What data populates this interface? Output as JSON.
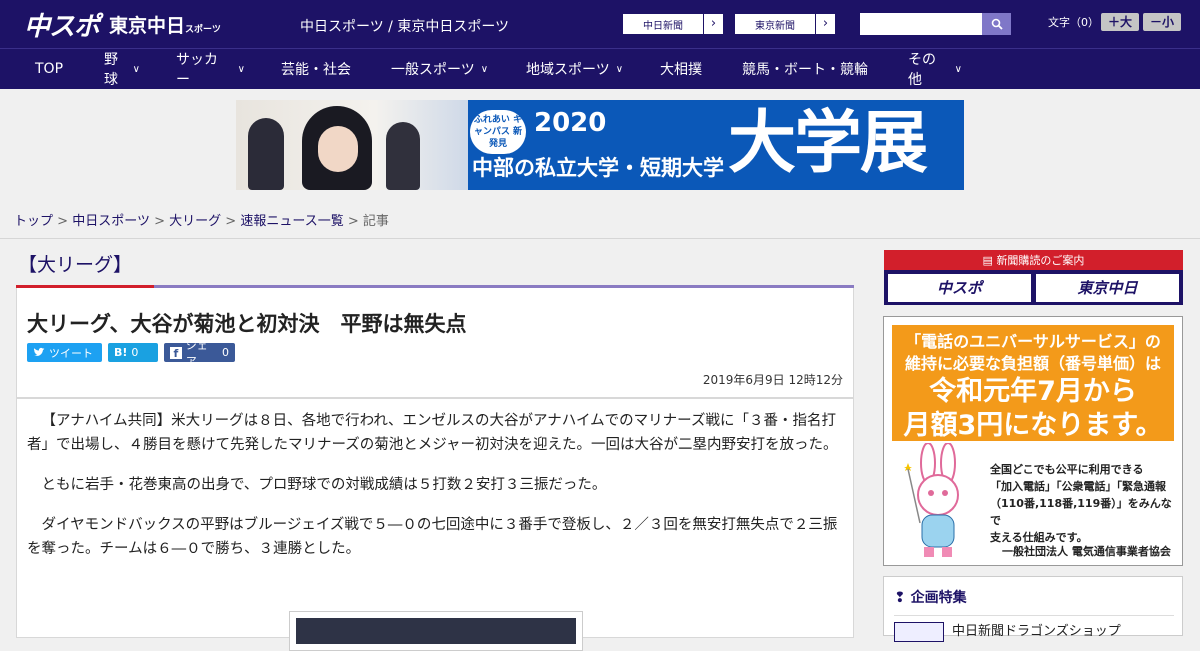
{
  "header": {
    "logo_main": "中スポ",
    "logo_sub": "東京中日",
    "logo_sub_small": "スポーツ",
    "site_title": "中日スポーツ / 東京中日スポーツ",
    "ext_links": [
      {
        "label": "中日新聞",
        "arrow": "›"
      },
      {
        "label": "東京新聞",
        "arrow": "›"
      }
    ],
    "search_placeholder": "",
    "font_size_label": "文字（0）",
    "font_up": "＋大",
    "font_down": "－小"
  },
  "nav": {
    "items": [
      {
        "label": "TOP",
        "has_menu": false
      },
      {
        "label": "野球",
        "has_menu": true
      },
      {
        "label": "サッカー",
        "has_menu": true
      },
      {
        "label": "芸能・社会",
        "has_menu": false
      },
      {
        "label": "一般スポーツ",
        "has_menu": true
      },
      {
        "label": "地域スポーツ",
        "has_menu": true
      },
      {
        "label": "大相撲",
        "has_menu": false
      },
      {
        "label": "競馬・ボート・競輪",
        "has_menu": false
      },
      {
        "label": "その他",
        "has_menu": true
      }
    ]
  },
  "banner": {
    "badge": "ふれあい キャンパス 新発見",
    "year": "2020",
    "subtitle": "中部の私立大学・短期大学",
    "big": "大学展"
  },
  "breadcrumb": {
    "items": [
      "トップ",
      "中日スポーツ",
      "大リーグ",
      "速報ニュース一覧"
    ],
    "current": "記事",
    "sep": ">"
  },
  "article": {
    "category": "【大リーグ】",
    "headline": "大リーグ、大谷が菊池と初対決　平野は無失点",
    "share": {
      "tweet": "ツイート",
      "hatena": "B!",
      "hatena_count": "0",
      "facebook": "シェア",
      "facebook_count": "0"
    },
    "date": "2019年6月9日 12時12分",
    "paragraphs": [
      "【アナハイム共同】米大リーグは８日、各地で行われ、エンゼルスの大谷がアナハイムでのマリナーズ戦に「３番・指名打者」で出場し、４勝目を懸けて先発したマリナーズの菊池とメジャー初対決を迎えた。一回は大谷が二塁内野安打を放った。",
      "ともに岩手・花巻東高の出身で、プロ野球での対戦成績は５打数２安打３三振だった。",
      "ダイヤモンドバックスの平野はブルージェイズ戦で５―０の七回途中に３番手で登板し、２／３回を無安打無失点で２三振を奪った。チームは６―０で勝ち、３連勝とした。"
    ]
  },
  "sidebar": {
    "subscribe_header": "新聞購読のご案内",
    "subscribe_buttons": [
      "中スポ",
      "東京中日"
    ],
    "ad": {
      "line1": "「電話のユニバーサルサービス」の",
      "line2": "維持に必要な負担額（番号単価）は",
      "line3": "令和元年7月から",
      "line4": "月額3円になります。",
      "text1": "全国どこでも公平に利用できる",
      "text2": "「加入電話」「公衆電話」「緊急通報",
      "text3": "（110番,118番,119番）」をみんなで",
      "text4": "支える仕組みです。",
      "footer": "一般社団法人 電気通信事業者協会"
    },
    "feature_title": "企画特集",
    "feature_item": "中日新聞ドラゴンズショップ"
  }
}
